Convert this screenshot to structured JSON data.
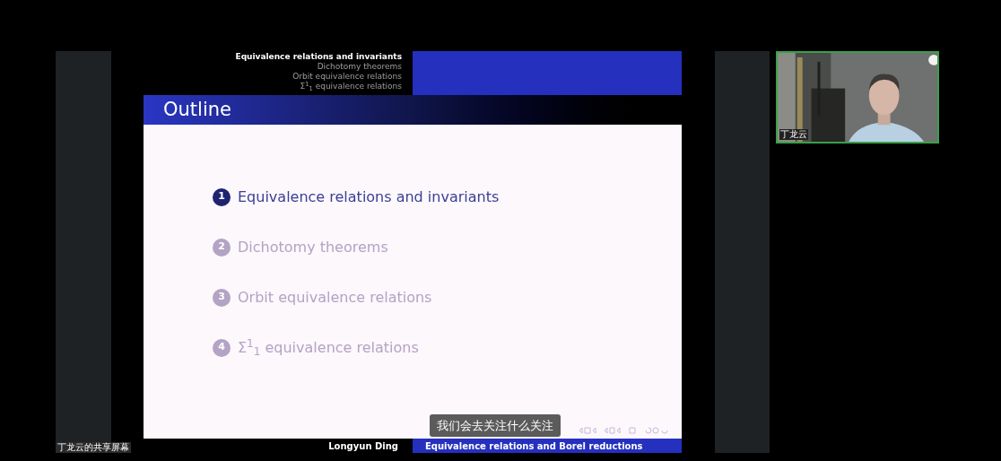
{
  "slide": {
    "header_nav": [
      {
        "text": "Equivalence relations and invariants",
        "selected": true
      },
      {
        "text": "Dichotomy theorems",
        "selected": false
      },
      {
        "text": "Orbit equivalence relations",
        "selected": false
      },
      {
        "text": "Σ$^{1}$$_{1}$ equivalence relations",
        "selected": false
      }
    ],
    "title": "Outline",
    "outline": [
      {
        "number": "1",
        "text": "Equivalence relations and invariants",
        "selected": true
      },
      {
        "number": "2",
        "text": "Dichotomy theorems",
        "selected": false
      },
      {
        "number": "3",
        "text": "Orbit equivalence relations",
        "selected": false
      },
      {
        "number": "4",
        "text": "Σ$^{1}$$_{1}$ equivalence relations",
        "selected": false
      }
    ],
    "footer": {
      "author": "Longyun Ding",
      "title": "Equivalence relations and Borel reductions"
    }
  },
  "subtitle": "我们会去关注什么关注",
  "share_label": "丁龙云的共享屏幕",
  "video": {
    "name_tag": "丁龙云"
  }
}
